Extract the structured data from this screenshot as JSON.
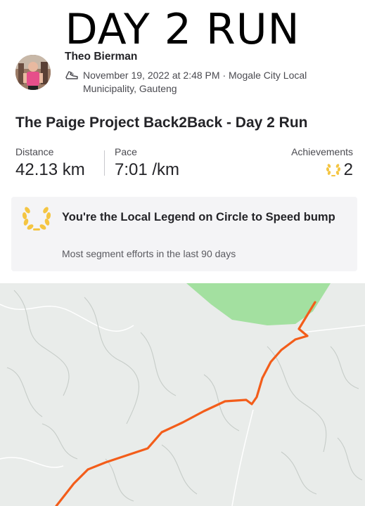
{
  "overlay_title": "DAY 2 RUN",
  "athlete": {
    "name": "Theo Bierman",
    "activity_icon": "running-shoe-icon",
    "meta": "November 19, 2022 at 2:48 PM · Mogale City Local Municipality, Gauteng"
  },
  "activity": {
    "title": "The Paige Project Back2Back - Day 2 Run"
  },
  "stats": {
    "distance_label": "Distance",
    "distance_value": "42.13 km",
    "pace_label": "Pace",
    "pace_value": "7:01 /km",
    "achievements_label": "Achievements",
    "achievements_value": "2",
    "achievements_icon": "laurel-icon"
  },
  "local_legend": {
    "icon": "laurel-wreath-icon",
    "title": "You're the Local Legend on Circle to Speed bump",
    "subtitle": "Most segment efforts in the last 90 days"
  },
  "colors": {
    "route": "#f35d1a",
    "legend_gold": "#f4c542",
    "map_bg": "#e9ecea",
    "park_green": "#a3e0a0"
  }
}
